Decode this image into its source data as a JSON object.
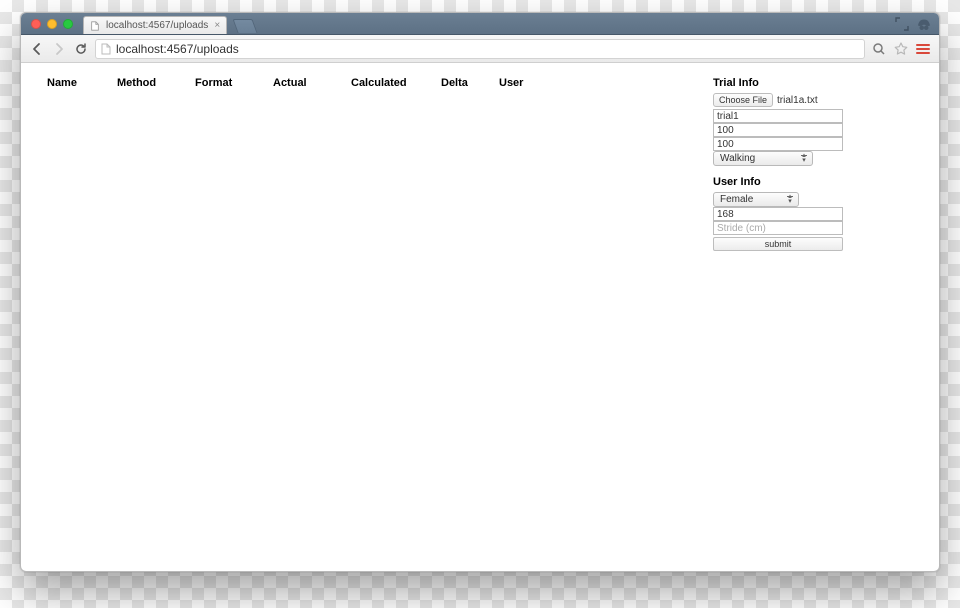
{
  "browser": {
    "tab_title": "localhost:4567/uploads",
    "url": "localhost:4567/uploads"
  },
  "table": {
    "headers": [
      "Name",
      "Method",
      "Format",
      "Actual",
      "Calculated",
      "Delta",
      "User"
    ]
  },
  "trial": {
    "heading": "Trial Info",
    "choose_label": "Choose File",
    "file_name": "trial1a.txt",
    "name_value": "trial1",
    "val1": "100",
    "val2": "100",
    "activity": "Walking"
  },
  "user": {
    "heading": "User Info",
    "gender": "Female",
    "height": "168",
    "stride_placeholder": "Stride (cm)",
    "submit": "submit"
  }
}
